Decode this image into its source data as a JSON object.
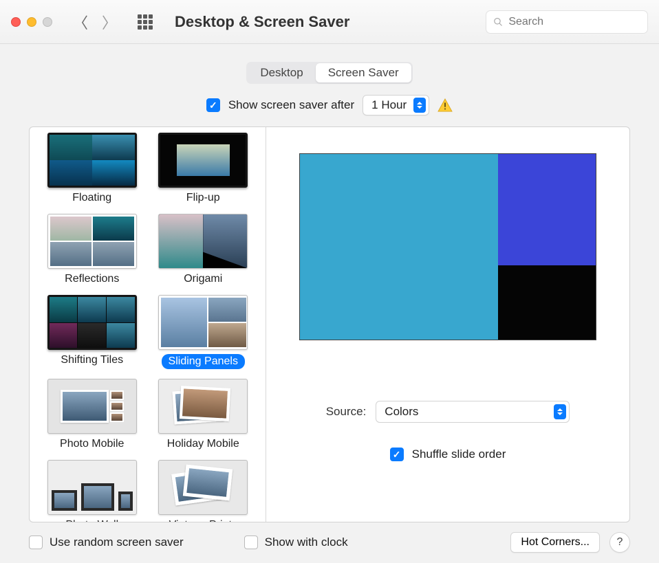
{
  "window": {
    "title": "Desktop & Screen Saver"
  },
  "search": {
    "placeholder": "Search"
  },
  "tabs": {
    "desktop": "Desktop",
    "screensaver": "Screen Saver",
    "active": "screensaver"
  },
  "showAfter": {
    "checked": true,
    "label": "Show screen saver after",
    "value": "1 Hour"
  },
  "savers": [
    {
      "label": "Floating",
      "variant": "tm-floating",
      "frame": "darkframe",
      "selected": false
    },
    {
      "label": "Flip-up",
      "variant": "tm-flipup",
      "frame": "darkframe",
      "selected": false
    },
    {
      "label": "Reflections",
      "variant": "tm-reflections",
      "frame": "",
      "selected": false
    },
    {
      "label": "Origami",
      "variant": "tm-origami",
      "frame": "",
      "selected": false
    },
    {
      "label": "Shifting Tiles",
      "variant": "tm-shifting",
      "frame": "darkframe",
      "selected": false
    },
    {
      "label": "Sliding Panels",
      "variant": "tm-sliding",
      "frame": "",
      "selected": true
    },
    {
      "label": "Photo Mobile",
      "variant": "tm-photomobile",
      "frame": "",
      "selected": false
    },
    {
      "label": "Holiday Mobile",
      "variant": "tm-holidaymobile",
      "frame": "",
      "selected": false
    },
    {
      "label": "Photo Wall",
      "variant": "tm-photowall",
      "frame": "",
      "selected": false
    },
    {
      "label": "Vintage Prints",
      "variant": "tm-vintage",
      "frame": "",
      "selected": false
    }
  ],
  "source": {
    "label": "Source:",
    "value": "Colors"
  },
  "shuffle": {
    "checked": true,
    "label": "Shuffle slide order"
  },
  "footer": {
    "random": {
      "checked": false,
      "label": "Use random screen saver"
    },
    "clock": {
      "checked": false,
      "label": "Show with clock"
    },
    "hotCorners": "Hot Corners...",
    "help": "?"
  }
}
